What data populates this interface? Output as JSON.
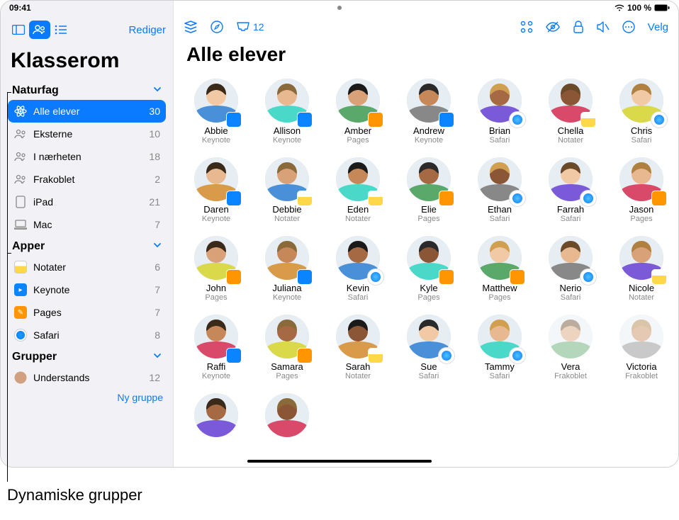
{
  "status": {
    "time": "09:41",
    "battery": "100 %"
  },
  "sidebar": {
    "edit": "Rediger",
    "title": "Klasserom",
    "sections": [
      {
        "title": "Naturfag",
        "rows": [
          {
            "icon": "atom",
            "label": "Alle elever",
            "count": "30",
            "active": true
          },
          {
            "icon": "people",
            "label": "Eksterne",
            "count": "10"
          },
          {
            "icon": "people",
            "label": "I nærheten",
            "count": "18"
          },
          {
            "icon": "people",
            "label": "Frakoblet",
            "count": "2"
          },
          {
            "icon": "ipad",
            "label": "iPad",
            "count": "21"
          },
          {
            "icon": "mac",
            "label": "Mac",
            "count": "7"
          }
        ]
      },
      {
        "title": "Apper",
        "rows": [
          {
            "icon": "app-notater",
            "label": "Notater",
            "count": "6"
          },
          {
            "icon": "app-keynote",
            "label": "Keynote",
            "count": "7"
          },
          {
            "icon": "app-pages",
            "label": "Pages",
            "count": "7"
          },
          {
            "icon": "app-safari",
            "label": "Safari",
            "count": "8"
          }
        ]
      },
      {
        "title": "Grupper",
        "rows": [
          {
            "icon": "avatar",
            "label": "Understands",
            "count": "12"
          }
        ]
      }
    ],
    "newgroup": "Ny gruppe"
  },
  "main": {
    "title": "Alle elever",
    "toolbar_inbox_count": "12",
    "velg": "Velg",
    "students": [
      [
        {
          "name": "Abbie",
          "app": "Keynote",
          "badge": "keynote"
        },
        {
          "name": "Allison",
          "app": "Keynote",
          "badge": "keynote"
        },
        {
          "name": "Amber",
          "app": "Pages",
          "badge": "pages"
        },
        {
          "name": "Andrew",
          "app": "Keynote",
          "badge": "keynote"
        },
        {
          "name": "Brian",
          "app": "Safari",
          "badge": "safari"
        },
        {
          "name": "Chella",
          "app": "Notater",
          "badge": "notater"
        },
        {
          "name": "Chris",
          "app": "Safari",
          "badge": "safari"
        }
      ],
      [
        {
          "name": "Daren",
          "app": "Keynote",
          "badge": "keynote"
        },
        {
          "name": "Debbie",
          "app": "Notater",
          "badge": "notater"
        },
        {
          "name": "Eden",
          "app": "Notater",
          "badge": "notater"
        },
        {
          "name": "Elie",
          "app": "Pages",
          "badge": "pages"
        },
        {
          "name": "Ethan",
          "app": "Safari",
          "badge": "safari"
        },
        {
          "name": "Farrah",
          "app": "Safari",
          "badge": "safari"
        },
        {
          "name": "Jason",
          "app": "Pages",
          "badge": "pages"
        }
      ],
      [
        {
          "name": "John",
          "app": "Pages",
          "badge": "pages"
        },
        {
          "name": "Juliana",
          "app": "Keynote",
          "badge": "keynote"
        },
        {
          "name": "Kevin",
          "app": "Safari",
          "badge": "safari"
        },
        {
          "name": "Kyle",
          "app": "Pages",
          "badge": "pages"
        },
        {
          "name": "Matthew",
          "app": "Pages",
          "badge": "pages"
        },
        {
          "name": "Nerio",
          "app": "Safari",
          "badge": "safari"
        },
        {
          "name": "Nicole",
          "app": "Notater",
          "badge": "notater"
        }
      ],
      [
        {
          "name": "Raffi",
          "app": "Keynote",
          "badge": "keynote"
        },
        {
          "name": "Samara",
          "app": "Pages",
          "badge": "pages"
        },
        {
          "name": "Sarah",
          "app": "Notater",
          "badge": "notater"
        },
        {
          "name": "Sue",
          "app": "Safari",
          "badge": "safari"
        },
        {
          "name": "Tammy",
          "app": "Safari",
          "badge": "safari"
        },
        {
          "name": "Vera",
          "app": "Frakoblet",
          "badge": "",
          "faded": true
        },
        {
          "name": "Victoria",
          "app": "Frakoblet",
          "badge": "",
          "faded": true
        }
      ],
      [
        {
          "name": "",
          "app": "",
          "badge": ""
        },
        {
          "name": "",
          "app": "",
          "badge": ""
        }
      ]
    ]
  },
  "annotation": "Dynamiske grupper"
}
